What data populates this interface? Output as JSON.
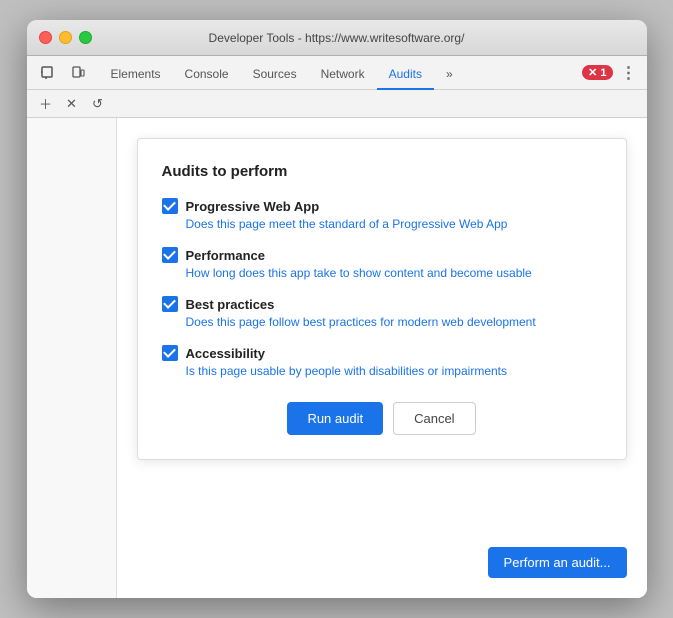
{
  "window": {
    "title": "Developer Tools - https://www.writesoftware.org/"
  },
  "traffic_lights": {
    "close": "close",
    "minimize": "minimize",
    "maximize": "maximize"
  },
  "tabs": [
    {
      "id": "elements",
      "label": "Elements",
      "active": false
    },
    {
      "id": "console",
      "label": "Console",
      "active": false
    },
    {
      "id": "sources",
      "label": "Sources",
      "active": false
    },
    {
      "id": "network",
      "label": "Network",
      "active": false
    },
    {
      "id": "audits",
      "label": "Audits",
      "active": true
    },
    {
      "id": "more",
      "label": "»",
      "active": false
    }
  ],
  "error_badge": {
    "icon": "✕",
    "count": "1"
  },
  "audit_dialog": {
    "title": "Audits to perform",
    "items": [
      {
        "id": "pwa",
        "name": "Progressive Web App",
        "description": "Does this page meet the standard of a Progressive Web App",
        "checked": true
      },
      {
        "id": "performance",
        "name": "Performance",
        "description": "How long does this app take to show content and become usable",
        "checked": true
      },
      {
        "id": "best-practices",
        "name": "Best practices",
        "description": "Does this page follow best practices for modern web development",
        "checked": true
      },
      {
        "id": "accessibility",
        "name": "Accessibility",
        "description": "Is this page usable by people with disabilities or impairments",
        "checked": true
      }
    ],
    "run_button": "Run audit",
    "cancel_button": "Cancel"
  },
  "perform_audit_button": "Perform an audit..."
}
